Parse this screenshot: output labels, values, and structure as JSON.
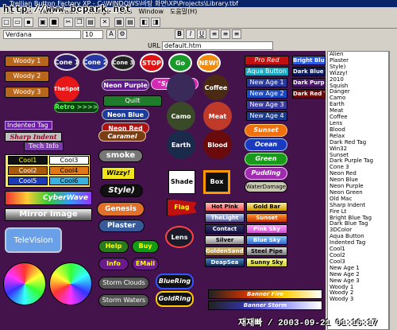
{
  "window": {
    "title": "Trellian Button Factory XP - C:\\WINDOWS\\바탕 화면\\XP\\Projects\\Library.tbf"
  },
  "watermark": "http://www.bcpark.net",
  "menu": {
    "items": [
      "File",
      "Edit",
      "View",
      "Insert",
      "Arrange",
      "Tools",
      "Window",
      "도움말(H)"
    ]
  },
  "font": {
    "family": "Verdana",
    "size": "10"
  },
  "url": {
    "label": "URL",
    "value": "default.htm"
  },
  "stamp": "재재빠 / 2003-09-21 01:16:17",
  "left_buttons": [
    "Woody 1",
    "Woody 2",
    "Woody 3"
  ],
  "circles": [
    "Cone 1",
    "Cone 2",
    "Cone 3",
    "STOP",
    "Go",
    "NEW!"
  ],
  "the_spot": "TheSpot",
  "retro": "Retro >>>>",
  "neon": [
    "Neon Purple",
    "Neon Blue",
    "Neon Red"
  ],
  "sparkle": "\"Sparkle\"",
  "quilt": "Quilt",
  "caramel": "Caramel",
  "smoke": "smoke",
  "wizzy": "Wizzy!",
  "style": "Style)",
  "genesis": "Genesis",
  "plaster": "Plaster",
  "help": "Help",
  "buy": "Buy",
  "info": "Info",
  "email": "EMail",
  "storm": [
    "Storm Clouds",
    "Storm Waters"
  ],
  "rings": [
    "BlueRing",
    "GoldRing"
  ],
  "planets": [
    "Coffee",
    "Camo",
    "Meat",
    "Earth",
    "Blood",
    "Lens"
  ],
  "indented": "Indented Tag",
  "sharp": "Sharp Indent",
  "techinfo": "Tech Info",
  "cools": [
    "Cool1",
    "Cool3",
    "Cool2",
    "Cool4",
    "Cool5",
    "Cool6"
  ],
  "cyberwave": "CyberWave",
  "mirror": "Mirror Image",
  "television": "TeleVision",
  "shade": "Shade",
  "box": "Box",
  "flag": "Flag",
  "right_col": [
    "Pro Red",
    "Aqua Button",
    "New Age 1",
    "New Age 2",
    "New Age 3",
    "New Age 4"
  ],
  "ovals": [
    "Sunset",
    "Ocean",
    "Green",
    "Pudding",
    "WaterDamage"
  ],
  "bright": [
    "Bright Blue",
    "Dark Blue Tag",
    "Dark Purple",
    "Dark Red Tag"
  ],
  "grid": [
    "Hot Pink",
    "Gold Bar",
    "TheLight",
    "Sunset",
    "Contact",
    "Pink Sky",
    "Silver",
    "Blue Sky",
    "GoldenSands",
    "Steel Pipe",
    "DeapSea",
    "Sunny Sky"
  ],
  "banners": [
    "Banner Fire",
    "Banner Storm"
  ],
  "library": [
    "Alien",
    "Plaster",
    "Style)",
    "Wizzy!",
    "2010",
    "Squish",
    "Danger",
    "Camo",
    "Earth",
    "Meat",
    "Coffee",
    "Lens",
    "Blood",
    "Relax",
    "Dark Red Tag",
    "Win32",
    "Sunset",
    "Dark Purple Tag",
    "Cone 3",
    "Neon Red",
    "Neon Blue",
    "Neon Purple",
    "Neon Green",
    "Old Mac",
    "Sharp Indent",
    "Fire Lt",
    "Bright Blue Tag",
    "Dark Blue Tag",
    "3DColor",
    "Aqua Button",
    "Indented Tag",
    "Cool1",
    "Cool2",
    "Cool3",
    "New Age 1",
    "New Age 2",
    "New Age 3",
    "Woody 1",
    "Woody 2",
    "Woody 3"
  ]
}
